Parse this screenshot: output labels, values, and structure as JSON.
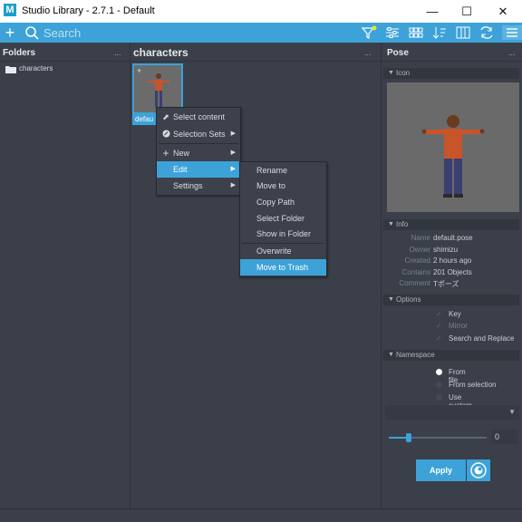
{
  "window": {
    "title": "Studio Library - 2.7.1 - Default",
    "logo_letter": "M"
  },
  "toolbar": {
    "search_placeholder": "Search"
  },
  "folders": {
    "header": "Folders",
    "more": "...",
    "items": [
      "characters"
    ]
  },
  "items": {
    "header": "characters",
    "more": "...",
    "thumbnail_label": "defau"
  },
  "context_menu": {
    "items": [
      {
        "label": "Select content",
        "icon": "cursor-icon"
      },
      {
        "label": "Selection Sets",
        "icon": "selection-sets-icon",
        "submenu": true
      },
      {
        "label": "New",
        "icon": "plus-icon",
        "submenu": true
      },
      {
        "label": "Edit",
        "submenu": true,
        "highlighted": true
      },
      {
        "label": "Settings",
        "submenu": true
      }
    ]
  },
  "edit_submenu": {
    "items": [
      "Rename",
      "Move to",
      "Copy Path",
      "Select Folder",
      "Show in Folder",
      "Overwrite",
      "Move to Trash"
    ],
    "highlighted": "Move to Trash"
  },
  "pose": {
    "header": "Pose",
    "more": "...",
    "icon_section": "Icon",
    "info_section": "Info",
    "info": [
      {
        "key": "Name",
        "value": "default.pose"
      },
      {
        "key": "Owner",
        "value": "shimizu"
      },
      {
        "key": "Created",
        "value": "2 hours ago"
      },
      {
        "key": "Contains",
        "value": "201 Objects"
      },
      {
        "key": "Comment",
        "value": "Tポーズ"
      }
    ],
    "options_section": "Options",
    "options": [
      "Key",
      "Mirror",
      "Search and Replace"
    ],
    "namespace_section": "Namespace",
    "namespace": [
      {
        "label": "From file",
        "selected": true
      },
      {
        "label": "From selection",
        "selected": false
      },
      {
        "label": "Use custom",
        "selected": false
      }
    ],
    "blend_value": "0",
    "blend_fraction": 0.2,
    "apply_label": "Apply"
  },
  "colors": {
    "accent": "#3da2d8",
    "background": "#3a3f4a"
  }
}
